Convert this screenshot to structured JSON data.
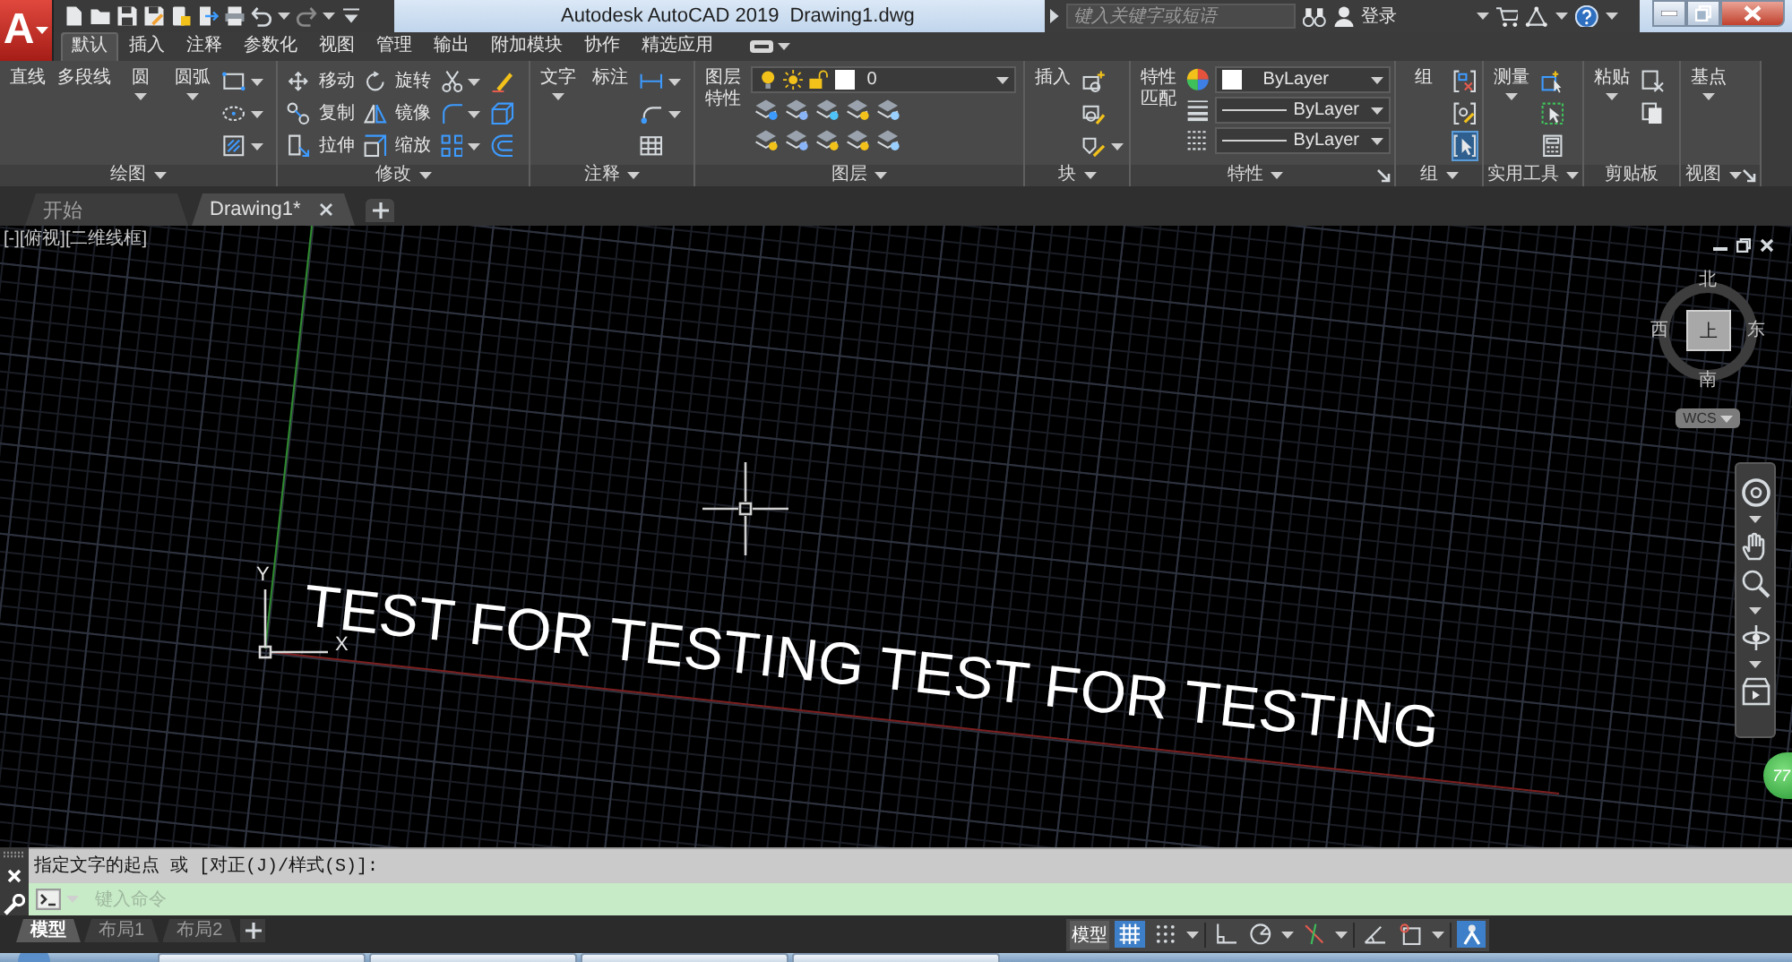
{
  "app_menu": {
    "label": "A"
  },
  "title_bar": {
    "title": "Autodesk AutoCAD 2019",
    "document": "Drawing1.dwg",
    "search": {
      "placeholder": "键入关键字或短语"
    },
    "sign_in": "登录"
  },
  "ribbon_tabs": [
    {
      "label": "默认",
      "selected": true
    },
    {
      "label": "插入",
      "selected": false
    },
    {
      "label": "注释",
      "selected": false
    },
    {
      "label": "参数化",
      "selected": false
    },
    {
      "label": "视图",
      "selected": false
    },
    {
      "label": "管理",
      "selected": false
    },
    {
      "label": "输出",
      "selected": false
    },
    {
      "label": "附加模块",
      "selected": false
    },
    {
      "label": "协作",
      "selected": false
    },
    {
      "label": "精选应用",
      "selected": false
    }
  ],
  "ribbon_panels": [
    {
      "title": "绘图",
      "menu": true,
      "launcher": false,
      "columns": [
        {
          "kind": "large",
          "label": "直线",
          "dropdown": false
        },
        {
          "kind": "large",
          "label": "多段线",
          "dropdown": false
        },
        {
          "kind": "large",
          "label": "圆",
          "dropdown": true
        },
        {
          "kind": "large",
          "label": "圆弧",
          "dropdown": true
        },
        {
          "kind": "stack",
          "items": [
            {
              "dropdown": true
            },
            {
              "dropdown": true
            },
            {
              "dropdown": true
            }
          ]
        }
      ]
    },
    {
      "title": "修改",
      "menu": true,
      "launcher": false,
      "columns": [
        {
          "kind": "stack",
          "items": [
            {
              "label": "移动",
              "dropdown": false
            },
            {
              "label": "复制",
              "dropdown": false
            },
            {
              "label": "拉伸",
              "dropdown": false
            }
          ]
        },
        {
          "kind": "stack",
          "items": [
            {
              "label": "旋转",
              "dropdown": false
            },
            {
              "label": "镜像",
              "dropdown": false
            },
            {
              "label": "缩放",
              "dropdown": false
            }
          ]
        },
        {
          "kind": "stack",
          "items": [
            {
              "dropdown": true
            },
            {
              "dropdown": true
            },
            {
              "dropdown": true
            }
          ]
        },
        {
          "kind": "stack",
          "items": [
            {
              "dropdown": false
            },
            {
              "dropdown": false
            },
            {
              "dropdown": false
            }
          ]
        }
      ]
    },
    {
      "title": "注释",
      "menu": true,
      "launcher": false,
      "columns": [
        {
          "kind": "large",
          "label": "文字",
          "dropdown": true
        },
        {
          "kind": "large",
          "label": "标注",
          "dropdown": false
        },
        {
          "kind": "stack",
          "items": [
            {
              "dropdown": true
            },
            {
              "dropdown": true
            },
            {
              "dropdown": false
            }
          ]
        }
      ]
    },
    {
      "title": "图层",
      "menu": true,
      "launcher": false,
      "columns": [
        {
          "kind": "large",
          "label": "图层特性",
          "dropdown": false
        },
        {
          "kind": "layer",
          "value": "0"
        }
      ]
    },
    {
      "title": "块",
      "menu": true,
      "launcher": false,
      "columns": [
        {
          "kind": "large",
          "label": "插入",
          "dropdown": false
        },
        {
          "kind": "stack",
          "items": [
            {
              "dropdown": false
            },
            {
              "dropdown": false
            },
            {
              "dropdown": true
            }
          ]
        }
      ]
    },
    {
      "title": "特性",
      "menu": true,
      "launcher": true,
      "columns": [
        {
          "kind": "large",
          "label": "特性匹配",
          "dropdown": false
        },
        {
          "kind": "props",
          "rows": [
            {
              "kind": "color",
              "value": "ByLayer",
              "color": "#ffffff"
            },
            {
              "kind": "line",
              "value": "ByLayer"
            },
            {
              "kind": "line",
              "value": "ByLayer"
            }
          ]
        }
      ]
    },
    {
      "title": "组",
      "menu": true,
      "launcher": false,
      "columns": [
        {
          "kind": "large",
          "label": "组",
          "dropdown": false
        },
        {
          "kind": "stack",
          "items": [
            {
              "dropdown": false,
              "on": false
            },
            {
              "dropdown": false,
              "on": false
            },
            {
              "dropdown": false,
              "on": true
            }
          ]
        }
      ]
    },
    {
      "title": "实用工具",
      "menu": true,
      "launcher": false,
      "columns": [
        {
          "kind": "large",
          "label": "测量",
          "dropdown": true
        },
        {
          "kind": "stack",
          "items": [
            {
              "dropdown": false
            },
            {
              "dropdown": false
            },
            {
              "dropdown": false
            }
          ]
        }
      ]
    },
    {
      "title": "剪贴板",
      "menu": false,
      "launcher": false,
      "columns": [
        {
          "kind": "large",
          "label": "粘贴",
          "dropdown": true
        },
        {
          "kind": "stack",
          "items": [
            {
              "dropdown": false
            },
            {
              "dropdown": false
            }
          ]
        }
      ]
    },
    {
      "title": "视图",
      "menu": true,
      "launcher": true,
      "columns": [
        {
          "kind": "large",
          "label": "基点",
          "dropdown": true
        }
      ]
    }
  ],
  "file_tabs": [
    {
      "label": "开始",
      "selected": false,
      "closable": false
    },
    {
      "label": "Drawing1*",
      "selected": true,
      "closable": true
    }
  ],
  "viewport": {
    "label": "[-][俯视][二维线框]",
    "compass": {
      "north": "北",
      "west": "西",
      "face": "上",
      "east": "东",
      "south": "南"
    },
    "coordinate_system": "WCS"
  },
  "drawing": {
    "text": "TEST FOR TESTING TEST FOR TESTING",
    "ucs": {
      "x": "X",
      "y": "Y"
    }
  },
  "floating_ball": {
    "label": "77"
  },
  "command_line": {
    "prompt": "指定文字的起点 或 [对正(J)/样式(S)]:",
    "placeholder": "键入命令"
  },
  "layout_tabs": [
    {
      "label": "模型",
      "selected": true
    },
    {
      "label": "布局1",
      "selected": false
    },
    {
      "label": "布局2",
      "selected": false
    }
  ],
  "status_bar": {
    "space": "模型",
    "toggles": [
      {
        "on": true,
        "dropdown": false
      },
      {
        "on": false,
        "dropdown": true
      },
      {
        "on": false,
        "dropdown": false
      },
      {
        "on": false,
        "dropdown": true
      },
      {
        "on": false,
        "dropdown": true
      },
      {
        "on": false,
        "dropdown": false
      },
      {
        "on": false,
        "dropdown": true
      },
      {
        "on": true,
        "dropdown": false
      }
    ]
  }
}
